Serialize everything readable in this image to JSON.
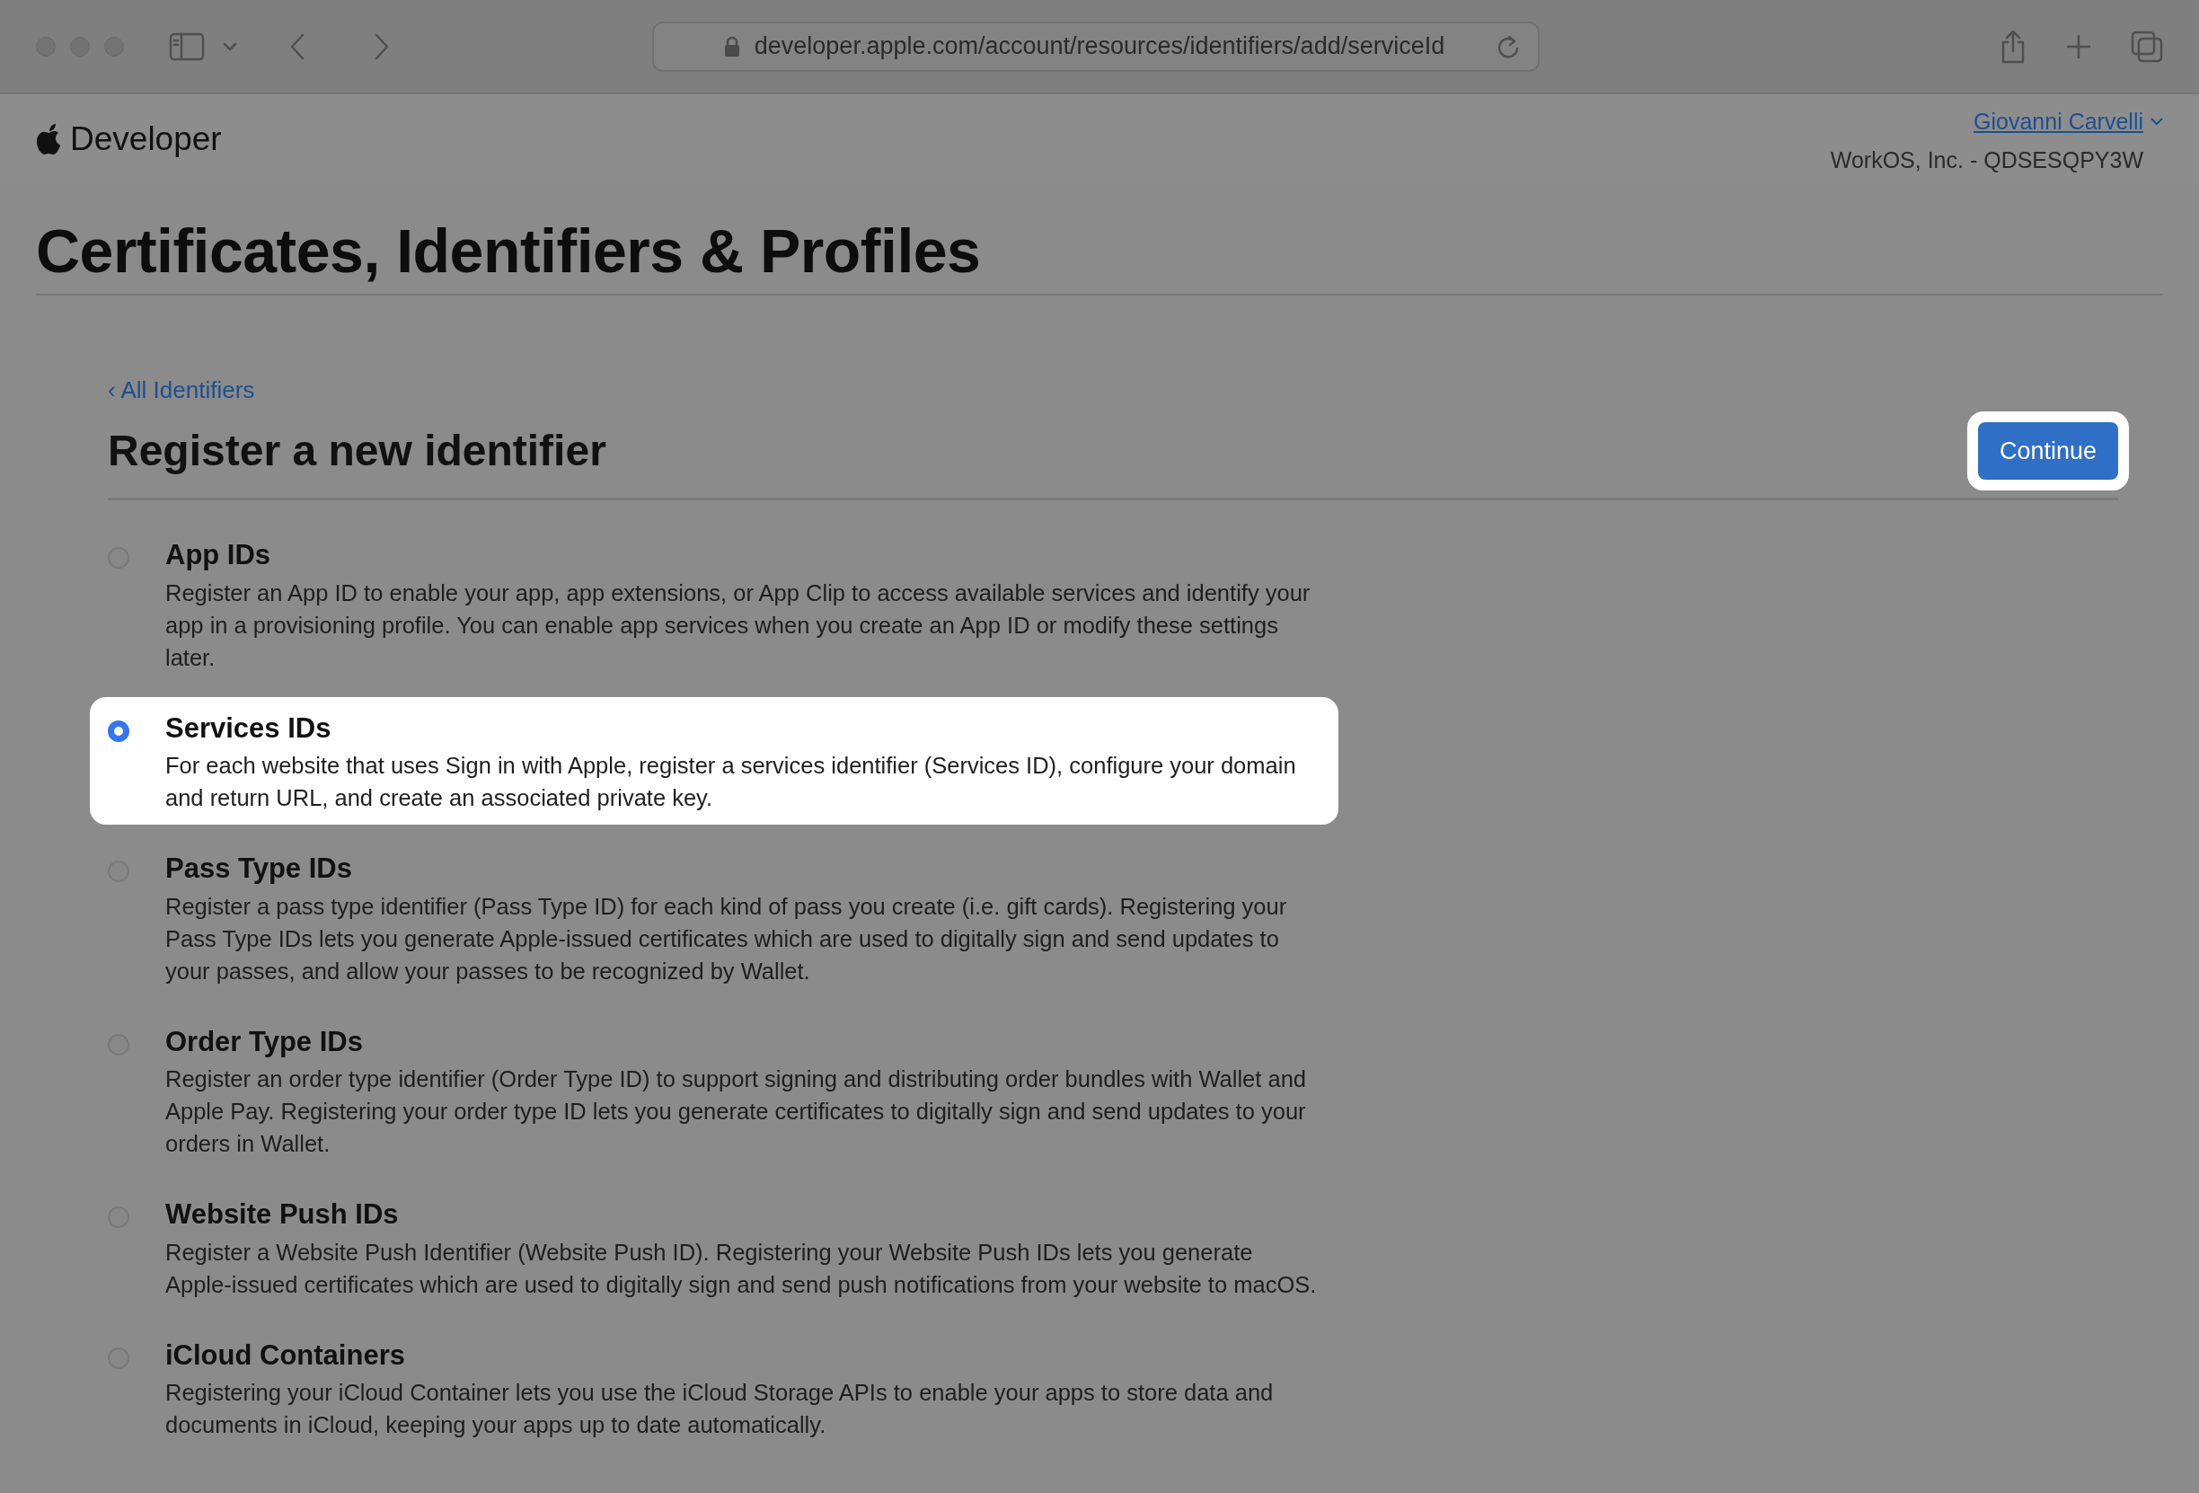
{
  "browser": {
    "url": "developer.apple.com/account/resources/identifiers/add/serviceId"
  },
  "header": {
    "logo_text": "Developer",
    "user_name": "Giovanni Carvelli",
    "team": "WorkOS, Inc. - QDSESQPY3W"
  },
  "page_title": "Certificates, Identifiers & Profiles",
  "back_link": "‹ All Identifiers",
  "section_title": "Register a new identifier",
  "continue_button": "Continue",
  "options": [
    {
      "title": "App IDs",
      "description": "Register an App ID to enable your app, app extensions, or App Clip to access available services and identify your app in a provisioning profile. You can enable app services when you create an App ID or modify these settings later.",
      "selected": false
    },
    {
      "title": "Services IDs",
      "description": "For each website that uses Sign in with Apple, register a services identifier (Services ID), configure your domain and return URL, and create an associated private key.",
      "selected": true
    },
    {
      "title": "Pass Type IDs",
      "description": "Register a pass type identifier (Pass Type ID) for each kind of pass you create (i.e. gift cards). Registering your Pass Type IDs lets you generate Apple-issued certificates which are used to digitally sign and send updates to your passes, and allow your passes to be recognized by Wallet.",
      "selected": false
    },
    {
      "title": "Order Type IDs",
      "description": "Register an order type identifier (Order Type ID) to support signing and distributing order bundles with Wallet and Apple Pay. Registering your order type ID lets you generate certificates to digitally sign and send updates to your orders in Wallet.",
      "selected": false
    },
    {
      "title": "Website Push IDs",
      "description": "Register a Website Push Identifier (Website Push ID). Registering your Website Push IDs lets you generate Apple-issued certificates which are used to digitally sign and send push notifications from your website to macOS.",
      "selected": false
    },
    {
      "title": "iCloud Containers",
      "description": "Registering your iCloud Container lets you use the iCloud Storage APIs to enable your apps to store data and documents in iCloud, keeping your apps up to date automatically.",
      "selected": false
    }
  ]
}
